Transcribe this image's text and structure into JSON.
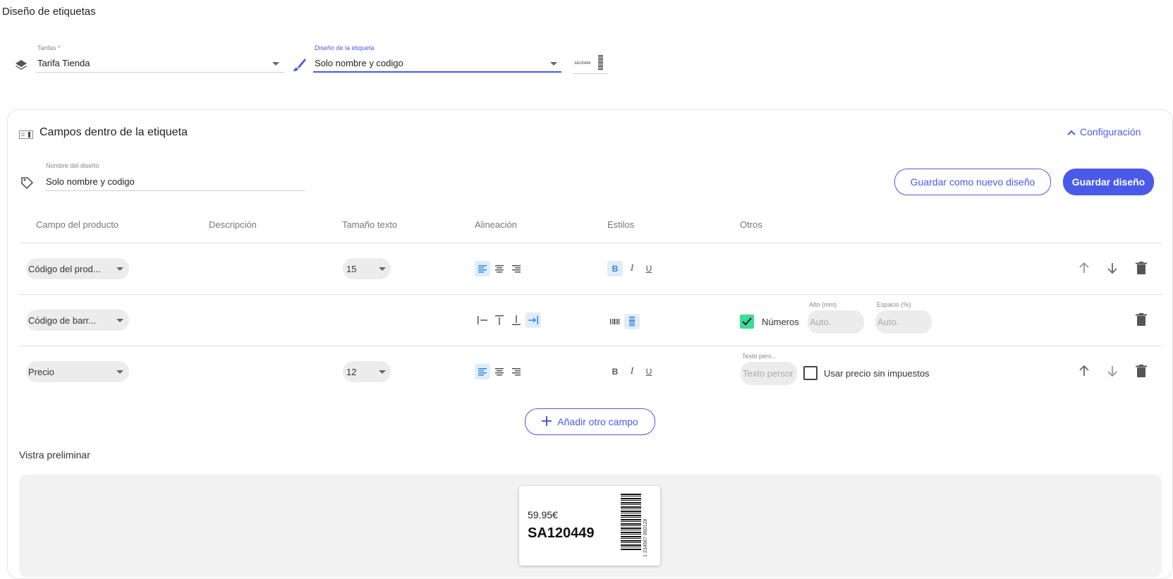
{
  "page": {
    "title": "Diseño de etiquetas"
  },
  "top": {
    "tarifas": {
      "label": "Tarifas *",
      "value": "Tarifa Tienda"
    },
    "diseno": {
      "label": "Diseño de la etiqueta",
      "value": "Solo nombre y codigo"
    },
    "thumb_text": "SA120449"
  },
  "card": {
    "title": "Campos dentro de la etiqueta",
    "config_label": "Configuración",
    "design_name": {
      "label": "Nombre del diseño",
      "value": "Solo nombre y codigo"
    },
    "save_new_label": "Guardar como nuevo diseño",
    "save_label": "Guardar diseño",
    "columns": [
      "Campo del producto",
      "Descripción",
      "Tamaño texto",
      "Alineación",
      "Estilos",
      "Otros"
    ],
    "rows": [
      {
        "field": "Código del prod...",
        "size": "15",
        "align_active": "left",
        "bold": true
      },
      {
        "field": "Código de barr...",
        "checkbox_label": "Números",
        "checked": true,
        "alto_label": "Alto (mm)",
        "alto_placeholder": "Auto.",
        "espacio_label": "Espacio (%)",
        "espacio_placeholder": "Auto."
      },
      {
        "field": "Precio",
        "size": "12",
        "align_active": "left",
        "bold": false,
        "texto_label": "Texto pers...",
        "texto_placeholder": "Texto persor",
        "checkbox_label": "Usar precio sin impuestos",
        "checked": false
      }
    ],
    "add_field_label": "Añadir otro campo",
    "preview_title": "Vistra preliminar",
    "preview": {
      "price": "59.95€",
      "code": "SA120449",
      "barcode_digits": "1 234567 890128"
    }
  },
  "colors": {
    "accent": "#4a5ae8",
    "check": "#3ddc97",
    "toggle_on": "#2a86d8"
  }
}
